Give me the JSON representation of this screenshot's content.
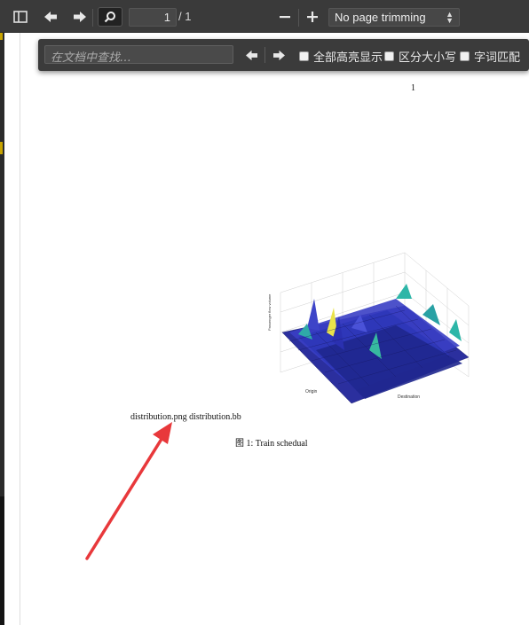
{
  "toolbar": {
    "page_number": "1",
    "page_total": "/ 1",
    "zoom_value": "No page trimming"
  },
  "findbar": {
    "placeholder": "在文档中查找…",
    "options": {
      "highlight_all": "全部高亮显示",
      "match_case": "区分大小写",
      "whole_word": "字词匹配"
    }
  },
  "document": {
    "page_number": "1",
    "file_label": "distribution.png distribution.bb",
    "caption": "图 1:  Train schedual",
    "figure": {
      "z_axis_label": "Passenger flow volume",
      "x_axis_label": "Origin",
      "y_axis_label": "Destination"
    }
  },
  "colors": {
    "toolbar_bg": "#3a3a3a",
    "annotation_arrow": "#e8383b"
  }
}
